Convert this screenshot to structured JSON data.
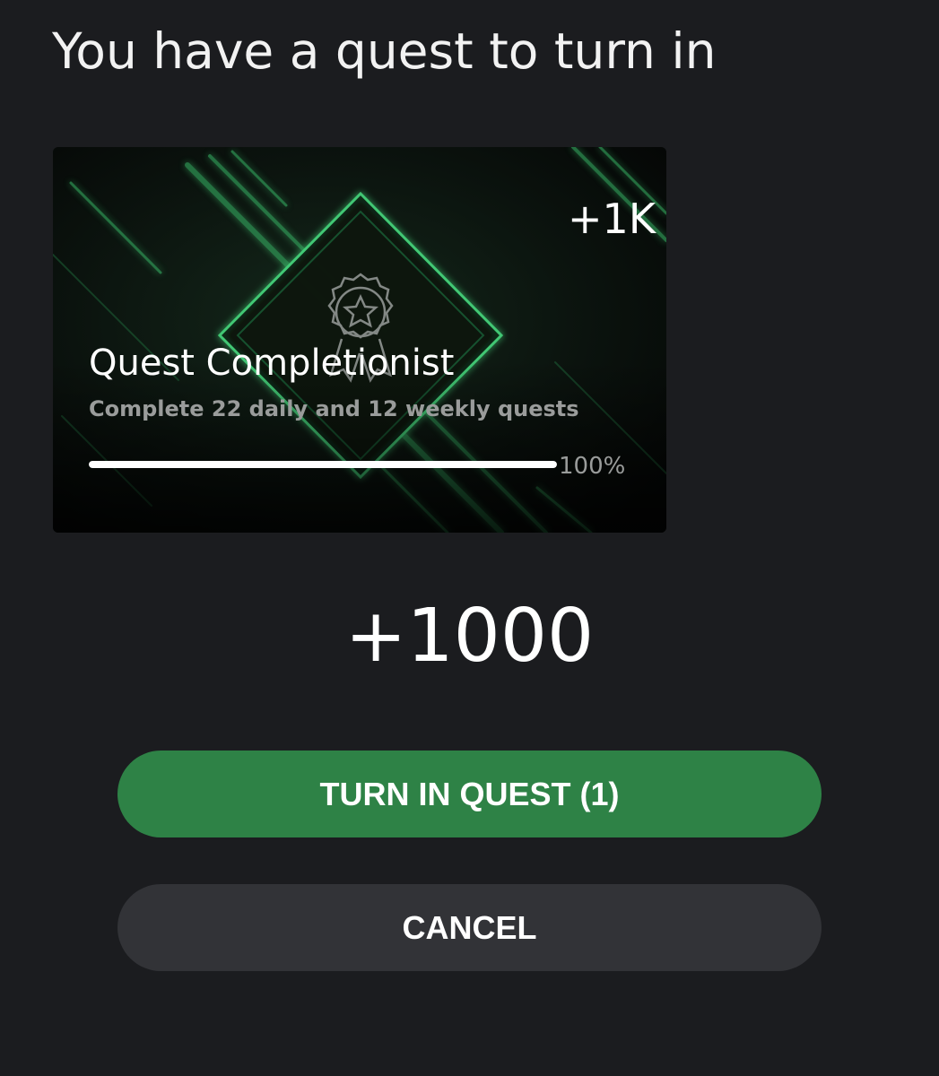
{
  "dialog": {
    "title": "You have a quest to turn in"
  },
  "quest_card": {
    "reward_badge": "+1K",
    "name": "Quest Completionist",
    "description": "Complete 22 daily and 12 weekly quests",
    "progress_percent": 100,
    "progress_label": "100%",
    "icon": "award-ribbon-icon"
  },
  "reward": {
    "amount": "+1000"
  },
  "buttons": {
    "turn_in_label": "TURN IN QUEST (1)",
    "cancel_label": "CANCEL"
  },
  "colors": {
    "background": "#1b1c1f",
    "accent_green": "#2e8246",
    "secondary_button": "#323337"
  }
}
